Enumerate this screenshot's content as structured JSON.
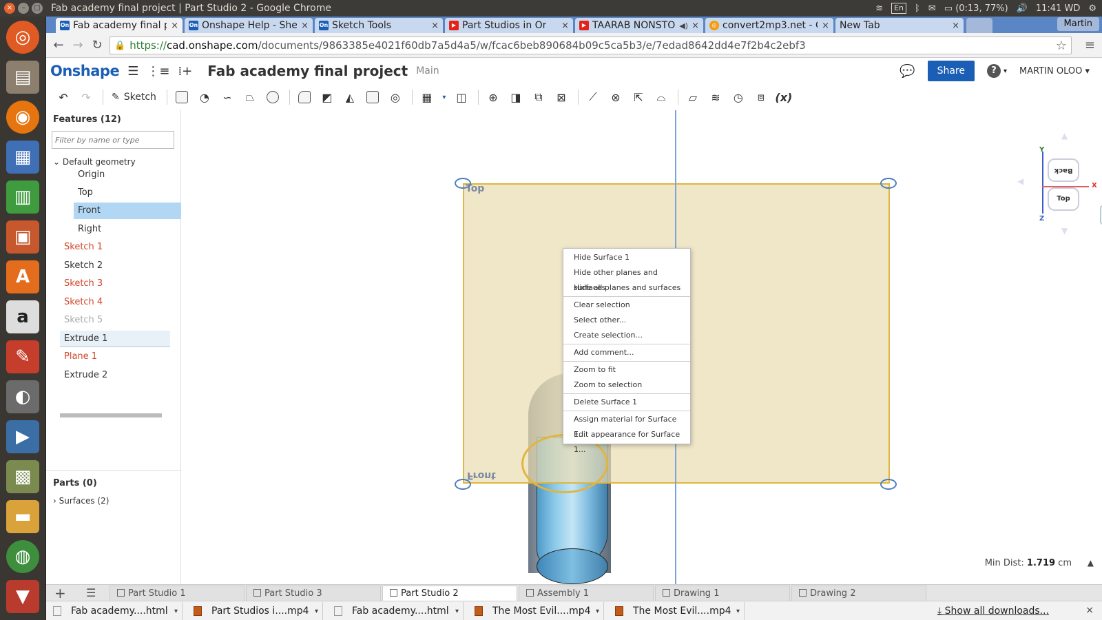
{
  "os": {
    "window_title": "Fab academy final project | Part Studio 2 - Google Chrome",
    "tray": {
      "keyboard": "En",
      "battery": "(0:13, 77%)",
      "time": "11:41 WD"
    }
  },
  "browser": {
    "tabs": [
      {
        "label": "Fab academy final p",
        "icon": "onshape"
      },
      {
        "label": "Onshape Help - Shel",
        "icon": "onshape"
      },
      {
        "label": "Sketch Tools",
        "icon": "onshape"
      },
      {
        "label": "Part Studios in Or",
        "icon": "youtube"
      },
      {
        "label": "TAARAB NONSTO",
        "icon": "youtube"
      },
      {
        "label": "convert2mp3.net - C",
        "icon": "mp3"
      },
      {
        "label": "New Tab",
        "icon": "none"
      }
    ],
    "profile": "Martin",
    "url_scheme": "https://",
    "url_host": "cad.onshape.com",
    "url_path": "/documents/9863385e4021f60db7a5d4a5/w/fcac6beb890684b09c5ca5b3/e/7edad8642dd4e7f2b4c2ebf3"
  },
  "app": {
    "logo": "Onshape",
    "doc_title": "Fab academy final project",
    "branch": "Main",
    "share_label": "Share",
    "help_label": "?",
    "user_label": "MARTIN OLOO ▾",
    "sketch_label": "Sketch",
    "variable_label": "(x)"
  },
  "feature_tree": {
    "title": "Features (12)",
    "filter_placeholder": "Filter by name or type",
    "group_label": "Default geometry",
    "items": [
      {
        "label": "Origin",
        "color": "#333333"
      },
      {
        "label": "Top",
        "color": "#333333"
      },
      {
        "label": "Front",
        "color": "#333333"
      },
      {
        "label": "Right",
        "color": "#333333"
      },
      {
        "label": "Sketch 1",
        "color": "#d2452c"
      },
      {
        "label": "Sketch 2",
        "color": "#333333"
      },
      {
        "label": "Sketch 3",
        "color": "#d2452c"
      },
      {
        "label": "Sketch 4",
        "color": "#d2452c"
      },
      {
        "label": "Sketch 5",
        "color": "#aaaaaa"
      },
      {
        "label": "Extrude 1",
        "color": "#333333"
      },
      {
        "label": "Plane 1",
        "color": "#d2452c"
      },
      {
        "label": "Extrude 2",
        "color": "#333333"
      }
    ],
    "parts_title": "Parts (0)",
    "surfaces_label": "Surfaces (2)"
  },
  "viewport": {
    "plane_label_top": "Top",
    "plane_label_front": "Front",
    "mindist_label": "Min Dist: ",
    "mindist_value": "1.719",
    "mindist_unit": " cm",
    "viewcube": {
      "back": "Back",
      "top": "Top",
      "axis_y": "Y",
      "axis_x": "X",
      "axis_z": "Z"
    }
  },
  "context_menu": {
    "groups": [
      [
        "Hide Surface 1",
        "Hide other planes and surfaces",
        "Hide all planes and surfaces"
      ],
      [
        "Clear selection",
        "Select other...",
        "Create selection..."
      ],
      [
        "Add comment..."
      ],
      [
        "Zoom to fit",
        "Zoom to selection"
      ],
      [
        "Delete Surface 1"
      ],
      [
        "Assign material for Surface 1...",
        "Edit appearance for Surface 1..."
      ]
    ]
  },
  "bottom_tabs": [
    "Part Studio 1",
    "Part Studio 3",
    "Part Studio 2",
    "Assembly 1",
    "Drawing 1",
    "Drawing 2"
  ],
  "downloads": {
    "items": [
      {
        "name": "Fab academy....html",
        "type": "html"
      },
      {
        "name": "Part Studios i....mp4",
        "type": "mp4"
      },
      {
        "name": "Fab academy....html",
        "type": "html"
      },
      {
        "name": "The Most Evil....mp4",
        "type": "mp4"
      },
      {
        "name": "The Most Evil....mp4",
        "type": "mp4"
      }
    ],
    "show_all": "Show all downloads..."
  }
}
